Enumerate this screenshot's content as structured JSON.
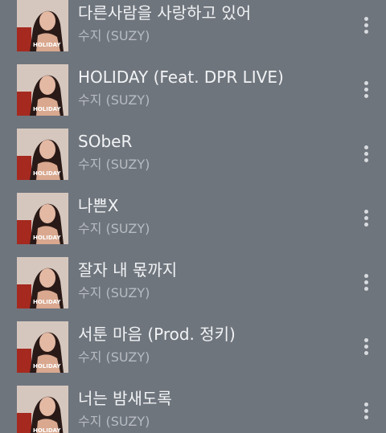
{
  "colors": {
    "background": "#6f757d",
    "title": "#f1f3f5",
    "artist": "#b7bcc2",
    "menu_dots": "#d8dbdf"
  },
  "album_art_text": "HOLIDAY",
  "songs": [
    {
      "title": "다른사람을 사랑하고 있어",
      "artist": "수지 (SUZY)"
    },
    {
      "title": "HOLIDAY (Feat. DPR LIVE)",
      "artist": "수지 (SUZY)"
    },
    {
      "title": "SObeR",
      "artist": "수지 (SUZY)"
    },
    {
      "title": "나쁜X",
      "artist": "수지 (SUZY)"
    },
    {
      "title": "잘자 내 몫까지",
      "artist": "수지 (SUZY)"
    },
    {
      "title": "서툰 마음 (Prod. 정키)",
      "artist": "수지 (SUZY)"
    },
    {
      "title": "너는 밤새도록",
      "artist": "수지 (SUZY)"
    }
  ],
  "icons": {
    "album_art": "album-art-image",
    "more": "more-vertical-icon"
  }
}
